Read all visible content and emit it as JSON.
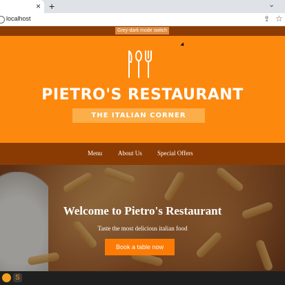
{
  "browser": {
    "close_glyph": "×",
    "new_tab_glyph": "+",
    "chevron_glyph": "⌄",
    "url": "localhost",
    "share_glyph": "⇪",
    "star_glyph": "☆"
  },
  "mode_switch": {
    "label": "Grey-dark mode switch"
  },
  "header": {
    "title": "PIETRO'S RESTAURANT",
    "subtitle": "THE ITALIAN CORNER",
    "brand_color": "#fd880e"
  },
  "nav": {
    "items": [
      {
        "label": "Menu"
      },
      {
        "label": "About Us"
      },
      {
        "label": "Special Offers"
      }
    ],
    "color": "#8a3b03"
  },
  "banner": {
    "title": "Welcome to Pietro's Restaurant",
    "tagline": "Taste the most delicious italian food",
    "button_label": "Book a table now"
  },
  "taskbar": {
    "icons": [
      "firefox-icon",
      "sublime-icon"
    ]
  }
}
